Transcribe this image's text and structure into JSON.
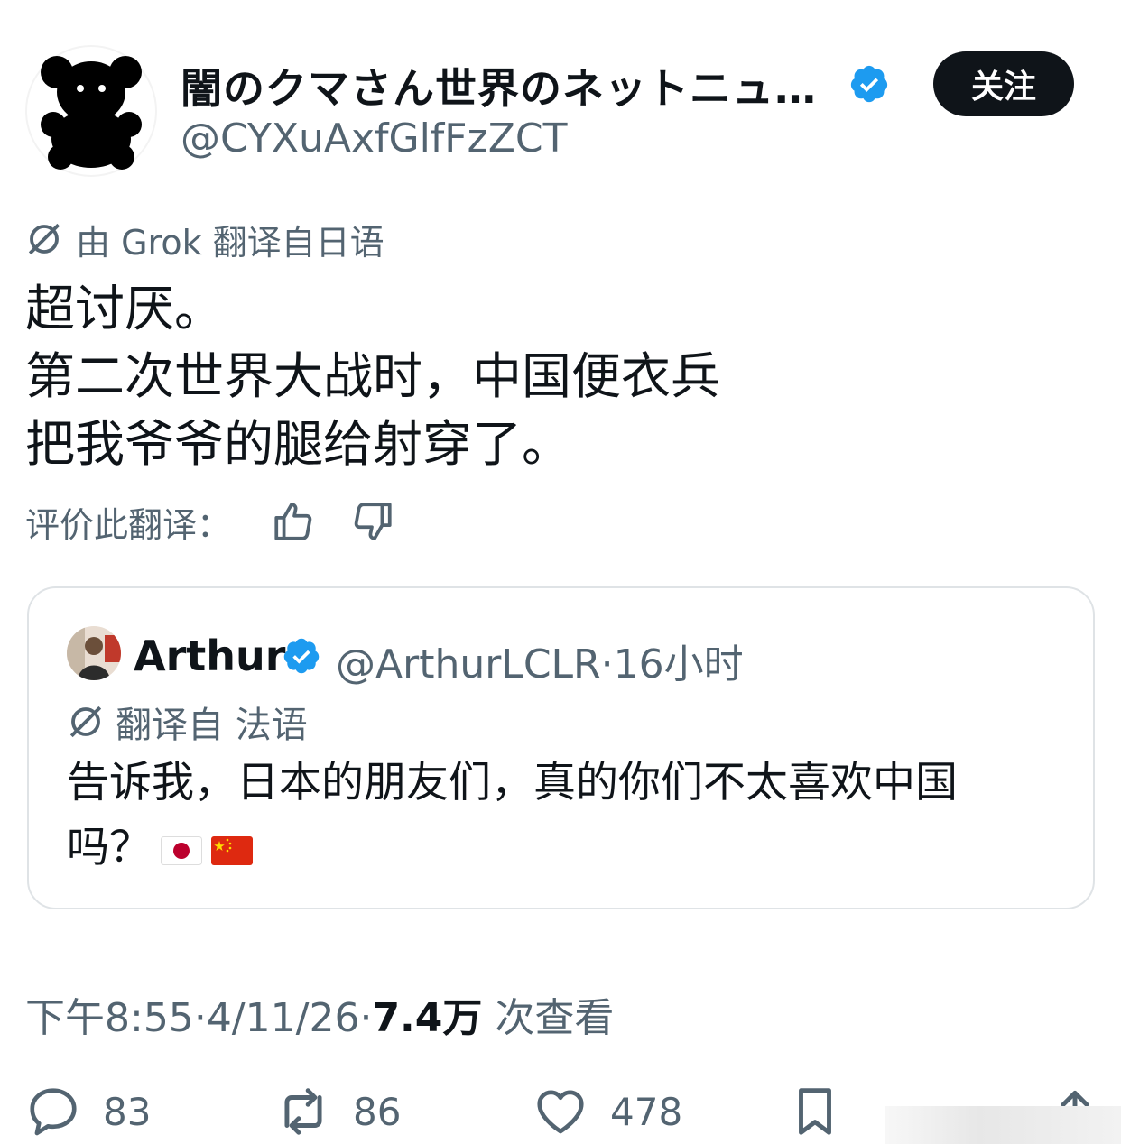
{
  "author": {
    "display_name": "闇のクマさん世界のネットニュ…",
    "handle": "@CYXuAxfGlfFzZCT",
    "avatar_icon": "black-bear-silhouette-icon",
    "verified": true
  },
  "follow_button": {
    "label": "关注"
  },
  "translation": {
    "icon": "translate-icon",
    "note": "由 Grok 翻译自日语"
  },
  "tweet": {
    "lines": [
      "超讨厌。",
      "第二次世界大战时，中国便衣兵",
      "把我爷爷的腿给射穿了。"
    ]
  },
  "rate_translation": {
    "label": "评价此翻译：",
    "thumbs_up_icon": "thumbs-up-icon",
    "thumbs_down_icon": "thumbs-down-icon"
  },
  "quoted_tweet": {
    "name": "Arthur",
    "verified": true,
    "handle": "@ArthurLCLR",
    "separator": "·",
    "time": "16小时",
    "translation_note": "翻译自 法语",
    "lines": [
      "告诉我，日本的朋友们，真的你们不太喜欢中国",
      "吗？"
    ],
    "flags": [
      "japan-flag-icon",
      "china-flag-icon"
    ]
  },
  "meta": {
    "time": "下午8:55",
    "date": "4/11/26",
    "views_count": "7.4万",
    "views_label": "次查看",
    "separator": "·"
  },
  "actions": {
    "replies": "83",
    "reposts": "86",
    "likes": "478"
  },
  "colors": {
    "text_primary": "#0f1419",
    "text_secondary": "#536471",
    "verified_blue": "#1d9bf0",
    "follow_bg": "#0f1419",
    "border": "#dfe3e6"
  }
}
